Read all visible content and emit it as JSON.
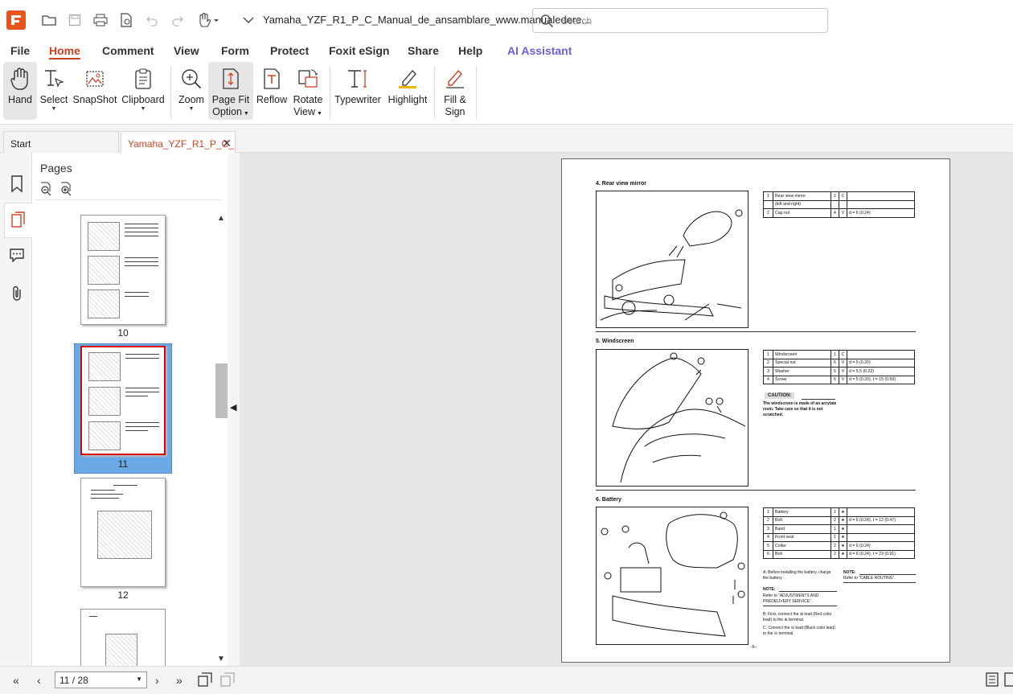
{
  "app": {
    "document_title": "Yamaha_YZF_R1_P_C_Manual_de_ansamblare_www.manualedere...",
    "search_placeholder": "Search"
  },
  "menu": {
    "items": [
      "File",
      "Home",
      "Comment",
      "View",
      "Form",
      "Protect",
      "Foxit eSign",
      "Share",
      "Help",
      "AI Assistant"
    ],
    "active": "Home"
  },
  "ribbon": {
    "hand": "Hand",
    "select": "Select",
    "snapshot": "SnapShot",
    "clipboard": "Clipboard",
    "zoom": "Zoom",
    "page_fit_1": "Page Fit",
    "page_fit_2": "Option",
    "reflow": "Reflow",
    "rotate_1": "Rotate",
    "rotate_2": "View",
    "typewriter": "Typewriter",
    "highlight": "Highlight",
    "fill_sign_1": "Fill &",
    "fill_sign_2": "Sign"
  },
  "tabs": {
    "start": "Start",
    "doc": "Yamaha_YZF_R1_P_C_..."
  },
  "pages_panel": {
    "title": "Pages",
    "thumbs": [
      {
        "label": "10"
      },
      {
        "label": "11",
        "selected": true
      },
      {
        "label": "12"
      }
    ]
  },
  "doc_page": {
    "sec4": {
      "title": "4. Rear view mirror",
      "rows": [
        [
          "1",
          "Rear view mirror",
          "2",
          "C",
          ""
        ],
        [
          "",
          "(left and right)",
          "",
          "",
          ""
        ],
        [
          "2",
          "Cap nut",
          "4",
          "V",
          "d = 6 (0.24)"
        ]
      ]
    },
    "sec5": {
      "title": "5. Windscreen",
      "rows": [
        [
          "1",
          "Windscreen",
          "1",
          "C",
          ""
        ],
        [
          "2",
          "Special nut",
          "6",
          "V",
          "d = 5 (0.20)"
        ],
        [
          "3",
          "Washer",
          "6",
          "V",
          "d = 5.5 (0.22)"
        ],
        [
          "4",
          "Screw",
          "6",
          "V",
          "d = 5 (0.20), ℓ = 15 (0.59)"
        ]
      ],
      "caution_label": "CAUTION:",
      "caution_text": "The windscreen is made of an acrylate resin. Take care so that it is not scratched."
    },
    "sec6": {
      "title": "6. Battery",
      "rows": [
        [
          "1",
          "Battery",
          "1",
          "★",
          ""
        ],
        [
          "2",
          "Bolt",
          "2",
          "★",
          "d = 6 (0.24), ℓ = 12 (0.47)"
        ],
        [
          "3",
          "Band",
          "1",
          "★",
          ""
        ],
        [
          "4",
          "Front seat",
          "1",
          "★",
          ""
        ],
        [
          "5",
          "Collar",
          "2",
          "★",
          "d = 6 (0.24)"
        ],
        [
          "6",
          "Bolt",
          "2",
          "★",
          "d = 6 (0.24), ℓ = 23 (0.91)"
        ]
      ],
      "note_a": "A: Before installing the battery, charge the battery.",
      "note_label": "NOTE:",
      "note_ref": "Refer to “ADJUSTMENTS AND PREDELIVERY SERVICE”.",
      "note_b": "B: First, connect the ⊕ lead (Red color lead) to the ⊕ terminal.",
      "note_c": "C: Connect the ⊖ lead (Black color lead) to the ⊖ terminal.",
      "note2_label": "NOTE:",
      "note2_text": "Refer to “CABLE ROUTING”."
    },
    "page_footer": "–6–"
  },
  "status": {
    "page_indicator": "11 / 28"
  }
}
